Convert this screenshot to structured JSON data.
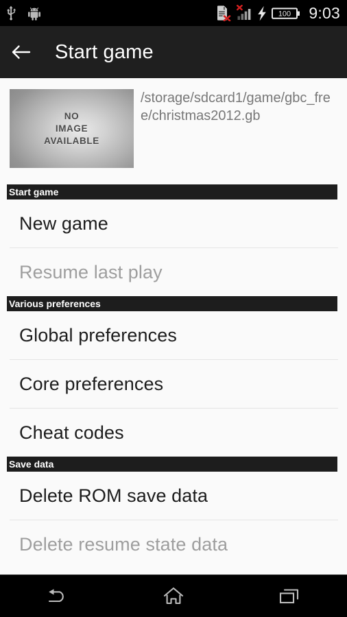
{
  "status_bar": {
    "left_icons": [
      {
        "name": "usb-icon",
        "label": "USB"
      },
      {
        "name": "android-robot-icon",
        "label": "Android"
      }
    ],
    "right_icons": [
      {
        "name": "sdcard-error-icon",
        "label": "SD card error"
      },
      {
        "name": "signal-no-service-icon",
        "label": "No signal"
      },
      {
        "name": "charging-bolt-icon",
        "label": "Charging"
      },
      {
        "name": "battery-icon",
        "label": "Battery"
      }
    ],
    "battery_level": "100",
    "clock": "9:03"
  },
  "app_bar": {
    "back_icon": "arrow-left-icon",
    "title": "Start game"
  },
  "rom_header": {
    "thumbnail": {
      "line1": "NO",
      "line2": "IMAGE",
      "line3": "AVAILABLE"
    },
    "path": "/storage/sdcard1/game/gbc_free/christmas2012.gb"
  },
  "sections": [
    {
      "header": "Start game",
      "rows": [
        {
          "label": "New game",
          "enabled": true
        },
        {
          "label": "Resume last play",
          "enabled": false
        }
      ]
    },
    {
      "header": "Various preferences",
      "rows": [
        {
          "label": "Global preferences",
          "enabled": true
        },
        {
          "label": "Core preferences",
          "enabled": true
        },
        {
          "label": "Cheat codes",
          "enabled": true
        }
      ]
    },
    {
      "header": "Save data",
      "rows": [
        {
          "label": "Delete ROM save data",
          "enabled": true
        },
        {
          "label": "Delete resume state data",
          "enabled": false
        }
      ]
    }
  ],
  "nav_bar": {
    "buttons": [
      {
        "name": "nav-back-button",
        "icon": "back-arrow-icon",
        "label": "Back"
      },
      {
        "name": "nav-home-button",
        "icon": "home-icon",
        "label": "Home"
      },
      {
        "name": "nav-recents-button",
        "icon": "recents-icon",
        "label": "Recents"
      }
    ]
  },
  "colors": {
    "status_bar_bg": "#000000",
    "app_bar_bg": "#1f1f1f",
    "page_bg": "#fafafa",
    "section_header_bg": "#1d1d1d",
    "enabled_text": "#1c1c1c",
    "disabled_text": "#9e9e9e",
    "divider": "#e4e4e4",
    "error_red": "#d32020"
  }
}
